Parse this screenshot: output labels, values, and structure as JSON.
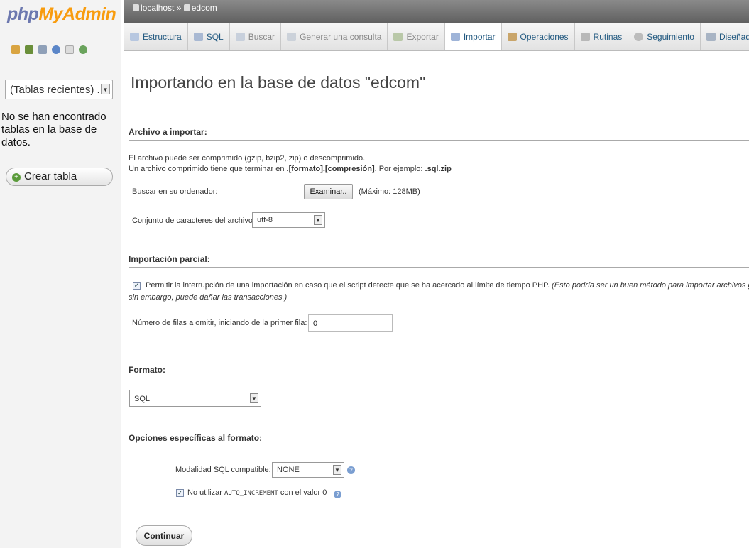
{
  "app": {
    "logo_php": "php",
    "logo_myadmin": "MyAdmin"
  },
  "sidebar": {
    "icons": [
      "home-icon",
      "table-icon",
      "query-icon",
      "info-icon",
      "docs-icon",
      "reload-icon"
    ],
    "recent_select": "(Tablas recientes) ...",
    "no_tables": "No se han encontrado tablas en la base de datos.",
    "create_table": "Crear tabla"
  },
  "breadcrumb": {
    "server": "localhost",
    "sep": "»",
    "db": "edcom"
  },
  "tabs": [
    {
      "label": "Estructura",
      "icon": "structure-icon",
      "state": "normal"
    },
    {
      "label": "SQL",
      "icon": "sql-icon",
      "state": "normal"
    },
    {
      "label": "Buscar",
      "icon": "search-icon",
      "state": "disabled"
    },
    {
      "label": "Generar una consulta",
      "icon": "query-icon",
      "state": "disabled"
    },
    {
      "label": "Exportar",
      "icon": "export-icon",
      "state": "disabled"
    },
    {
      "label": "Importar",
      "icon": "import-icon",
      "state": "active"
    },
    {
      "label": "Operaciones",
      "icon": "wrench-icon",
      "state": "normal"
    },
    {
      "label": "Rutinas",
      "icon": "routines-icon",
      "state": "normal"
    },
    {
      "label": "Seguimiento",
      "icon": "eye-icon",
      "state": "normal"
    },
    {
      "label": "Diseñador",
      "icon": "designer-icon",
      "state": "normal"
    }
  ],
  "main": {
    "title": "Importando en la base de datos \"edcom\"",
    "file_section": {
      "heading": "Archivo a importar:",
      "line1": "El archivo puede ser comprimido (gzip, bzip2, zip) o descomprimido.",
      "line2_pre": "Un archivo comprimido tiene que terminar en ",
      "line2_bold": ".[formato].[compresión]",
      "line2_mid": ". Por ejemplo: ",
      "line2_ex": ".sql.zip",
      "browse_label": "Buscar en su ordenador:",
      "browse_button": "Examinar..",
      "max_size": "(Máximo: 128MB)",
      "charset_label": "Conjunto de caracteres del archivo:",
      "charset_value": "utf-8"
    },
    "partial_section": {
      "heading": "Importación parcial:",
      "allow_text": "Permitir la interrupción de una importación en caso que el script detecte que se ha acercado al límite de tiempo PHP.",
      "allow_note": "(Esto podría ser un buen método para importar archivos grande",
      "allow_note2": "sin embargo, puede dañar las transacciones.)",
      "allow_checked": true,
      "skip_label": "Número de filas a omitir, iniciando de la primer fila:",
      "skip_value": "0"
    },
    "format_section": {
      "heading": "Formato:",
      "value": "SQL"
    },
    "options_section": {
      "heading": "Opciones específicas al formato:",
      "compat_label": "Modalidad SQL compatible:",
      "compat_value": "NONE",
      "noauto_pre": "No utilizar ",
      "noauto_code": "AUTO_INCREMENT",
      "noauto_post": " con el valor 0",
      "noauto_checked": true
    },
    "submit": "Continuar"
  },
  "colors": {
    "link": "#235a81",
    "logo_blue": "#6c78af",
    "logo_orange": "#f89c0e"
  }
}
